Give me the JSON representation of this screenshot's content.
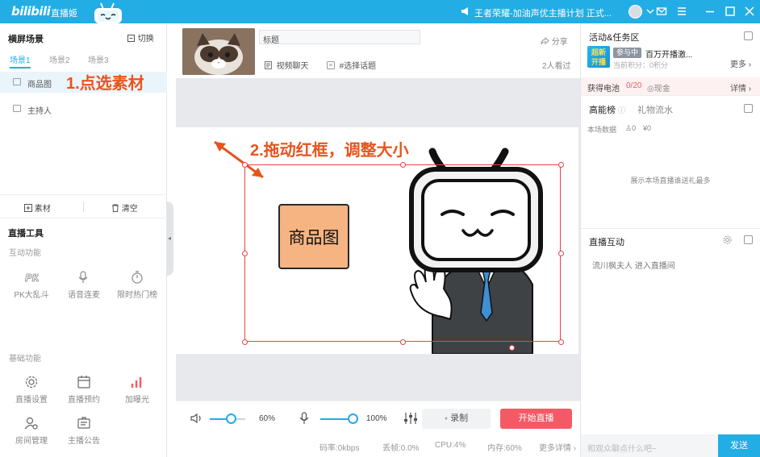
{
  "titlebar": {
    "logo": "bilibili",
    "app_name": "直播姬",
    "announcement": "王者荣耀-加油声优主播计划 正式...",
    "icons": [
      "announcement-icon",
      "avatar",
      "dropdown-icon",
      "mail-icon",
      "menu-icon",
      "minimize-icon",
      "maximize-icon",
      "close-icon"
    ]
  },
  "left": {
    "scene_title": "横屏场景",
    "switch_label": "切换",
    "scene_tabs": [
      "场景1",
      "场景2",
      "场景3"
    ],
    "sources": [
      "商品图",
      "主持人"
    ],
    "annotation_1": "1.点选素材",
    "add_source": "素材",
    "clear": "清空",
    "tools_title": "直播工具",
    "interactive_label": "互动功能",
    "interactive_tools": [
      "PK大乱斗",
      "语音连麦",
      "限时热门榜"
    ],
    "basic_label": "基础功能",
    "basic_tools": [
      "直播设置",
      "直播预约",
      "加曝光",
      "房间管理",
      "主播公告"
    ]
  },
  "center": {
    "title_value": "标题",
    "category": "视频聊天",
    "topic": "#选择话题",
    "share": "分享",
    "viewers": "2人看过",
    "annotation_2": "2.拖动红框，调整大小",
    "product_label": "商品图",
    "volume_pct": "60%",
    "mic_pct": "100%",
    "volume_level": 0.6,
    "mic_level": 1.0,
    "record_label": "录制",
    "live_label": "开始直播",
    "status": {
      "bitrate": "码率:0kbps",
      "drop": "丢帧:0.0%",
      "cpu": "CPU:4%",
      "mem": "内存:60%",
      "more": "更多详情"
    }
  },
  "right": {
    "activity_title": "活动&任务区",
    "promo_badge_l1": "超新",
    "promo_badge_l2": "开播",
    "joined": "参与中",
    "promo_name": "百万开播激...",
    "points": "当前积分：0积分",
    "more": "更多",
    "battery_label": "获得电池",
    "battery_value": "0/20",
    "cash": "◎现金",
    "details": "详情",
    "rank_tab": "高能榜",
    "gift_tab": "礼物流水",
    "session_label": "本场数据",
    "session_people": "0",
    "session_coin": "¥0",
    "rank_empty": "展示本场直播谁送礼最多",
    "interact_title": "直播互动",
    "chat_msg": "流川枫夫人 进入直播间",
    "chat_placeholder": "和观众聊点什么吧~",
    "send": "发送"
  },
  "colors": {
    "brand_blue": "#23ade5",
    "live_red": "#f45a65",
    "annotation_orange": "#e8541c",
    "frame_red": "#e8434b",
    "product_fill": "#f5b482"
  }
}
